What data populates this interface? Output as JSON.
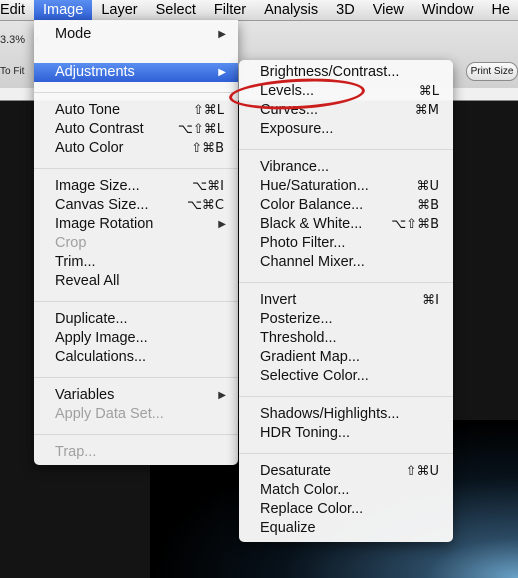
{
  "menubar": {
    "items": [
      "Edit",
      "Image",
      "Layer",
      "Select",
      "Filter",
      "Analysis",
      "3D",
      "View",
      "Window",
      "He"
    ]
  },
  "toolbar": {
    "zoom": "3.3%",
    "fit": "To Fit",
    "print_size": "Print Size"
  },
  "image_menu": {
    "items": [
      {
        "label": "Mode",
        "shortcut": "",
        "submenu": true
      },
      {
        "label": "Adjustments",
        "shortcut": "",
        "submenu": true
      },
      {
        "label": "Auto Tone",
        "shortcut": "⇧⌘L"
      },
      {
        "label": "Auto Contrast",
        "shortcut": "⌥⇧⌘L"
      },
      {
        "label": "Auto Color",
        "shortcut": "⇧⌘B"
      },
      {
        "label": "Image Size...",
        "shortcut": "⌥⌘I"
      },
      {
        "label": "Canvas Size...",
        "shortcut": "⌥⌘C"
      },
      {
        "label": "Image Rotation",
        "shortcut": "",
        "submenu": true
      },
      {
        "label": "Crop",
        "shortcut": ""
      },
      {
        "label": "Trim...",
        "shortcut": ""
      },
      {
        "label": "Reveal All",
        "shortcut": ""
      },
      {
        "label": "Duplicate...",
        "shortcut": ""
      },
      {
        "label": "Apply Image...",
        "shortcut": ""
      },
      {
        "label": "Calculations...",
        "shortcut": ""
      },
      {
        "label": "Variables",
        "shortcut": "",
        "submenu": true
      },
      {
        "label": "Apply Data Set...",
        "shortcut": ""
      },
      {
        "label": "Trap...",
        "shortcut": ""
      }
    ]
  },
  "adjustments_menu": {
    "items": [
      {
        "label": "Brightness/Contrast...",
        "shortcut": ""
      },
      {
        "label": "Levels...",
        "shortcut": "⌘L"
      },
      {
        "label": "Curves...",
        "shortcut": "⌘M"
      },
      {
        "label": "Exposure...",
        "shortcut": ""
      },
      {
        "label": "Vibrance...",
        "shortcut": ""
      },
      {
        "label": "Hue/Saturation...",
        "shortcut": "⌘U"
      },
      {
        "label": "Color Balance...",
        "shortcut": "⌘B"
      },
      {
        "label": "Black & White...",
        "shortcut": "⌥⇧⌘B"
      },
      {
        "label": "Photo Filter...",
        "shortcut": ""
      },
      {
        "label": "Channel Mixer...",
        "shortcut": ""
      },
      {
        "label": "Invert",
        "shortcut": "⌘I"
      },
      {
        "label": "Posterize...",
        "shortcut": ""
      },
      {
        "label": "Threshold...",
        "shortcut": ""
      },
      {
        "label": "Gradient Map...",
        "shortcut": ""
      },
      {
        "label": "Selective Color...",
        "shortcut": ""
      },
      {
        "label": "Shadows/Highlights...",
        "shortcut": ""
      },
      {
        "label": "HDR Toning...",
        "shortcut": ""
      },
      {
        "label": "Desaturate",
        "shortcut": "⇧⌘U"
      },
      {
        "label": "Match Color...",
        "shortcut": ""
      },
      {
        "label": "Replace Color...",
        "shortcut": ""
      },
      {
        "label": "Equalize",
        "shortcut": ""
      }
    ]
  },
  "colors": {
    "highlight": "#2e5fd6",
    "annotation": "#cc1d1d"
  }
}
